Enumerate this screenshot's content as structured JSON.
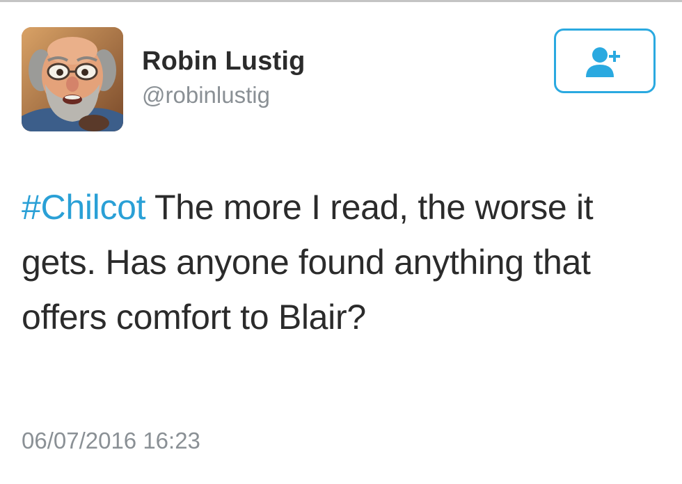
{
  "author": {
    "display_name": "Robin Lustig",
    "handle": "@robinlustig",
    "avatar_icon": "profile-photo"
  },
  "follow_button": {
    "icon": "add-user-icon",
    "color": "#2aa9e0"
  },
  "tweet": {
    "hashtag": "#Chilcot",
    "text": " The more I read, the worse it gets. Has anyone found anything that offers comfort to Blair?",
    "timestamp": "06/07/2016 16:23"
  },
  "colors": {
    "accent": "#2aa0d6",
    "text": "#2b2b2b",
    "muted": "#8a9095"
  }
}
